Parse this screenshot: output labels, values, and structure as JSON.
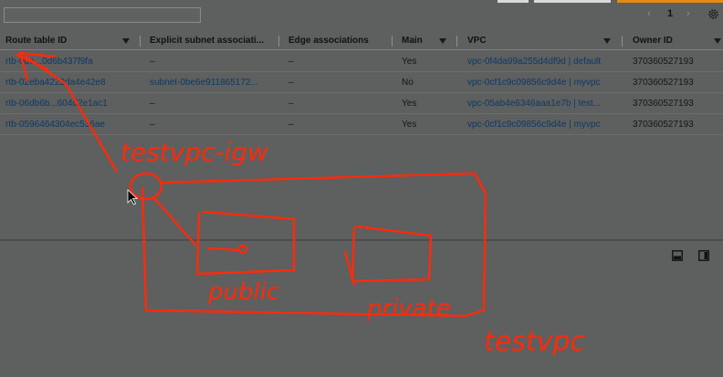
{
  "toolbar": {
    "search_value": "",
    "page_number": "1",
    "prev_glyph": "‹",
    "next_glyph": "›"
  },
  "table": {
    "columns": [
      {
        "label": "Route table ID",
        "sortable": true
      },
      {
        "label": "Explicit subnet associati...",
        "sortable": false
      },
      {
        "label": "Edge associations",
        "sortable": false
      },
      {
        "label": "Main",
        "sortable": true
      },
      {
        "label": "VPC",
        "sortable": true
      },
      {
        "label": "Owner ID",
        "sortable": true
      }
    ],
    "rows": [
      {
        "id": "rtb-0de...0d6b437f9fa",
        "subnet": "–",
        "edge": "–",
        "main": "Yes",
        "vpc": "vpc-0f4da99a255d4df9d | default",
        "owner": "370360527193"
      },
      {
        "id": "rtb-02eba4222da4e42e8",
        "subnet": "subnet-0be6e911865172...",
        "edge": "–",
        "main": "No",
        "vpc": "vpc-0cf1c9c09856c9d4e | myvpc",
        "owner": "370360527193"
      },
      {
        "id": "rtb-06db6b...604d2e1ac1",
        "subnet": "–",
        "edge": "–",
        "main": "Yes",
        "vpc": "vpc-05ab4e6346aaa1e7b | test...",
        "owner": "370360527193"
      },
      {
        "id": "rtb-0596464304ec536ae",
        "subnet": "–",
        "edge": "–",
        "main": "Yes",
        "vpc": "vpc-0cf1c9c09856c9d4e | myvpc",
        "owner": "370360527193"
      }
    ]
  },
  "annotations": {
    "label_igw": "testvpc-igw",
    "label_public": "public",
    "label_private": "private",
    "label_vpc": "testvpc"
  },
  "icons": {
    "sort": "caret-down-icon",
    "settings": "gear-icon",
    "panel_left": "panel-layout-icon",
    "panel_right": "panel-layout-icon"
  },
  "colors": {
    "background": "#5e5f5f",
    "annotation": "#ff2a0a",
    "link": "#0b3a66",
    "accent": "#e38a1a"
  }
}
